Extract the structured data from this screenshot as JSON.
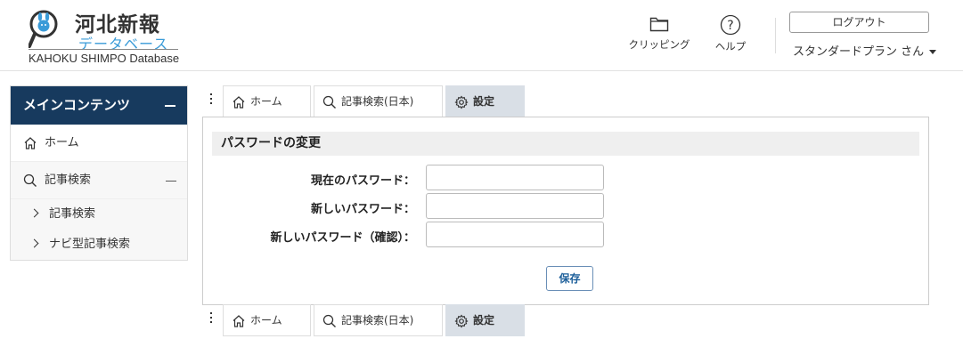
{
  "logo": {
    "title": "河北新報",
    "subtitle": "データベース",
    "english": "KAHOKU SHIMPO Database"
  },
  "header": {
    "clipping_label": "クリッピング",
    "help_label": "ヘルプ",
    "logout_label": "ログアウト",
    "plan_label": "スタンダードプラン さん"
  },
  "sidebar": {
    "title": "メインコンテンツ",
    "home_label": "ホーム",
    "search_label": "記事検索",
    "sub_items": [
      {
        "label": "記事検索"
      },
      {
        "label": "ナビ型記事検索"
      }
    ]
  },
  "tabs": [
    {
      "label": "ホーム",
      "icon": "home-icon"
    },
    {
      "label": "記事検索(日本)",
      "icon": "search-icon"
    },
    {
      "label": "設定",
      "icon": "gear-icon",
      "active": true
    }
  ],
  "form": {
    "section_title": "パスワードの変更",
    "current_password_label": "現在のパスワード：",
    "new_password_label": "新しいパスワード：",
    "confirm_password_label": "新しいパスワード（確認）：",
    "current_password_value": "",
    "new_password_value": "",
    "confirm_password_value": "",
    "save_label": "保存"
  },
  "colors": {
    "sidebar_header": "#173a5e",
    "active_tab": "#d9dfe6",
    "logo_blue": "#3a9bd8",
    "save_text": "#1d5f9a"
  }
}
